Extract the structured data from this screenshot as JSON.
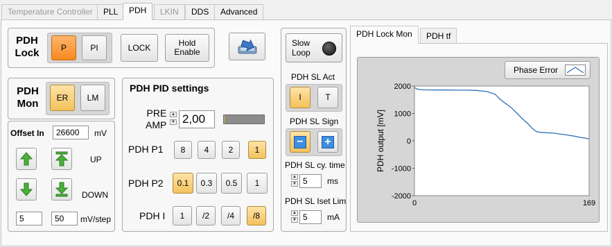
{
  "tabs": [
    {
      "label": "Temperature Controller",
      "state": "disabled"
    },
    {
      "label": "PLL",
      "state": "normal"
    },
    {
      "label": "PDH",
      "state": "active"
    },
    {
      "label": "LKIN",
      "state": "disabled"
    },
    {
      "label": "DDS",
      "state": "normal"
    },
    {
      "label": "Advanced",
      "state": "normal"
    }
  ],
  "lock": {
    "title_line1": "PDH",
    "title_line2": "Lock",
    "p_label": "P",
    "pi_label": "PI",
    "lock_label": "LOCK",
    "hold_line1": "Hold",
    "hold_line2": "Enable",
    "selected": "P"
  },
  "mon": {
    "title_line1": "PDH",
    "title_line2": "Mon",
    "er_label": "ER",
    "lm_label": "LM",
    "selected": "ER"
  },
  "offset": {
    "label": "Offset In",
    "value": "26600",
    "unit": "mV",
    "up_label": "UP",
    "down_label": "DOWN",
    "step1": "5",
    "step2": "50",
    "step_unit": "mV/step"
  },
  "pid": {
    "title": "PDH PID settings",
    "preamp_line1": "PRE",
    "preamp_line2": "AMP",
    "preamp_value": "2,00",
    "preamp_level": 0.02,
    "p1": {
      "label": "PDH P1",
      "options": [
        "8",
        "4",
        "2",
        "1"
      ],
      "selected": "1"
    },
    "p2": {
      "label": "PDH P2",
      "options": [
        "0.1",
        "0.3",
        "0.5",
        "1"
      ],
      "selected": "0.1"
    },
    "i": {
      "label": "PDH I",
      "options": [
        "1",
        "/2",
        "/4",
        "/8"
      ],
      "selected": "/8"
    }
  },
  "slow": {
    "loop_line1": "Slow",
    "loop_line2": "Loop",
    "act_label": "PDH SL Act",
    "act_i": "I",
    "act_t": "T",
    "act_selected": "I",
    "sign_label": "PDH SL Sign",
    "sign_minus": "−",
    "sign_plus": "+",
    "sign_selected": "minus",
    "cytime_label": "PDH SL cy. time",
    "cytime_value": "5",
    "cytime_unit": "ms",
    "iset_label": "PDH SL Iset Lim",
    "iset_value": "5",
    "iset_unit": "mA"
  },
  "graph_tabs": [
    "PDH Lock Mon",
    "PDH tf"
  ],
  "graph_legend": "Phase Error",
  "colors": {
    "accent_on": "#f2c25d",
    "accent_orange": "#f7891f",
    "trace": "#2b6fb6",
    "arrow_green": "#4caf3c",
    "sign_blue": "#3d8ede"
  },
  "chart_data": {
    "type": "line",
    "title": "",
    "xlabel": "",
    "ylabel": "PDH output [mV]",
    "xlim": [
      0,
      169
    ],
    "ylim": [
      -2000,
      2000
    ],
    "xticks": [
      "0",
      "169"
    ],
    "yticks": [
      "2000",
      "1000",
      "0",
      "-1000",
      "-2000"
    ],
    "grid": false,
    "series": [
      {
        "x": [
          0,
          2,
          5,
          10,
          20,
          30,
          40,
          50,
          60,
          70,
          78,
          82,
          86,
          90,
          94,
          98,
          102,
          106,
          110,
          114,
          118,
          122,
          126,
          130,
          135,
          140,
          145,
          150,
          155,
          160,
          165,
          169
        ],
        "values": [
          1950,
          1900,
          1870,
          1860,
          1855,
          1855,
          1850,
          1850,
          1840,
          1800,
          1700,
          1550,
          1420,
          1320,
          1200,
          1050,
          900,
          750,
          620,
          450,
          340,
          310,
          300,
          290,
          280,
          250,
          230,
          200,
          170,
          130,
          100,
          70
        ]
      }
    ]
  }
}
